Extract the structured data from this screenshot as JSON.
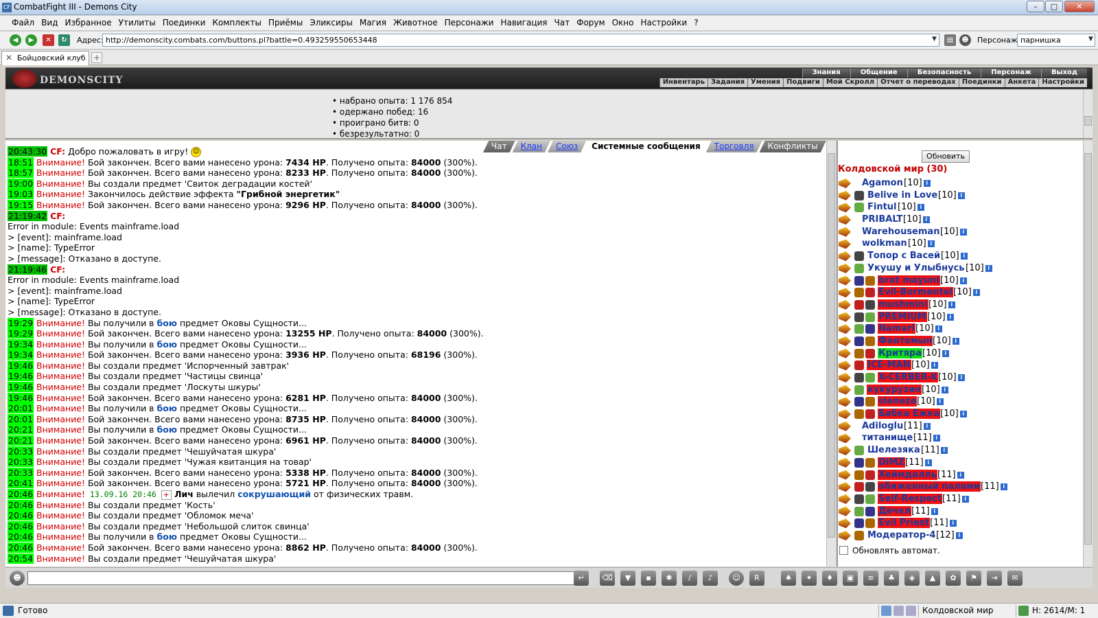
{
  "window": {
    "title": "CombatFight III - Demons City",
    "icon": "CF"
  },
  "menu": [
    "Файл",
    "Вид",
    "Избранное",
    "Утилиты",
    "Поединки",
    "Комплекты",
    "Приёмы",
    "Эликсиры",
    "Магия",
    "Животное",
    "Персонажи",
    "Навигация",
    "Чат",
    "Форум",
    "Окно",
    "Настройки",
    "?"
  ],
  "address": {
    "label": "Адрес:",
    "url": "http://demonscity.combats.com/buttons.pl?battle=0.493259550653448"
  },
  "persona": {
    "label": "Персонаж:",
    "value": "парнишка"
  },
  "tab": {
    "label": "Бойцовский клуб"
  },
  "game": {
    "logo": "DEMONSCITY",
    "nav_top": [
      "Знания",
      "Общение",
      "Безопасность",
      "Персонаж",
      "Выход"
    ],
    "nav_bottom": [
      "Инвентарь",
      "Задания",
      "Умения",
      "Подвиги",
      "Мой Скролл",
      "Отчет о переводах",
      "Поединки",
      "Анкета",
      "Настройки"
    ]
  },
  "stats": [
    "набрано опыта: 1 176 854",
    "одержано побед: 16",
    "проиграно битв: 0",
    "безрезультатно: 0"
  ],
  "chat_tabs": [
    {
      "label": "Чат",
      "style": "plain"
    },
    {
      "label": "Клан",
      "style": "link"
    },
    {
      "label": "Союз",
      "style": "link"
    },
    {
      "label": "Системные сообщения",
      "style": "active"
    },
    {
      "label": "Торговля",
      "style": "link"
    },
    {
      "label": "Конфликты",
      "style": "plain"
    }
  ],
  "chat_lines": [
    {
      "t": "20:43:30",
      "parts": [
        {
          "c": "cf",
          "v": "CF:"
        },
        {
          "v": " Добро пожаловать в игру! "
        }
      ],
      "smiley": true
    },
    {
      "t": "18:51",
      "parts": [
        {
          "c": "warn",
          "v": "Внимание!"
        },
        {
          "v": " Бой закончен. Всего вами нанесено урона: "
        },
        {
          "c": "b",
          "v": "7434 HP"
        },
        {
          "v": ". Получено опыта: "
        },
        {
          "c": "b",
          "v": "84000"
        },
        {
          "v": " (300%)."
        }
      ]
    },
    {
      "t": "18:57",
      "parts": [
        {
          "c": "warn",
          "v": "Внимание!"
        },
        {
          "v": " Бой закончен. Всего вами нанесено урона: "
        },
        {
          "c": "b",
          "v": "8233 HP"
        },
        {
          "v": ". Получено опыта: "
        },
        {
          "c": "b",
          "v": "84000"
        },
        {
          "v": " (300%)."
        }
      ]
    },
    {
      "t": "19:00",
      "parts": [
        {
          "c": "warn",
          "v": "Внимание!"
        },
        {
          "v": " Вы создали предмет 'Свиток деградации костей'"
        }
      ]
    },
    {
      "t": "19:03",
      "parts": [
        {
          "c": "warn",
          "v": "Внимание!"
        },
        {
          "v": " Закончилось действие эффекта "
        },
        {
          "c": "b",
          "v": "\"Грибной энергетик\""
        }
      ]
    },
    {
      "t": "19:15",
      "parts": [
        {
          "c": "warn",
          "v": "Внимание!"
        },
        {
          "v": " Бой закончен. Всего вами нанесено урона: "
        },
        {
          "c": "b",
          "v": "9296 HP"
        },
        {
          "v": ". Получено опыта: "
        },
        {
          "c": "b",
          "v": "84000"
        },
        {
          "v": " (300%)."
        }
      ]
    },
    {
      "t": "21:19:42",
      "parts": [
        {
          "c": "cf",
          "v": "CF:"
        }
      ]
    },
    {
      "parts": [
        {
          "v": "Error in module: Events mainframe.load"
        }
      ]
    },
    {
      "parts": [
        {
          "v": "> [event]: mainframe.load"
        }
      ]
    },
    {
      "parts": [
        {
          "v": "> [name]: TypeError"
        }
      ]
    },
    {
      "parts": [
        {
          "v": "> [message]: Отказано в доступе."
        }
      ]
    },
    {
      "t": "21:19:46",
      "parts": [
        {
          "c": "cf",
          "v": "CF:"
        }
      ]
    },
    {
      "parts": [
        {
          "v": "Error in module: Events mainframe.load"
        }
      ]
    },
    {
      "parts": [
        {
          "v": "> [event]: mainframe.load"
        }
      ]
    },
    {
      "parts": [
        {
          "v": "> [name]: TypeError"
        }
      ]
    },
    {
      "parts": [
        {
          "v": "> [message]: Отказано в доступе."
        }
      ]
    },
    {
      "t": "19:29",
      "parts": [
        {
          "c": "warn",
          "v": "Внимание!"
        },
        {
          "v": " Вы получили в "
        },
        {
          "c": "blue",
          "v": "бою"
        },
        {
          "v": " предмет Оковы Сущности..."
        }
      ]
    },
    {
      "t": "19:29",
      "parts": [
        {
          "c": "warn",
          "v": "Внимание!"
        },
        {
          "v": " Бой закончен. Всего вами нанесено урона: "
        },
        {
          "c": "b",
          "v": "13255 HP"
        },
        {
          "v": ". Получено опыта: "
        },
        {
          "c": "b",
          "v": "84000"
        },
        {
          "v": " (300%)."
        }
      ]
    },
    {
      "t": "19:34",
      "parts": [
        {
          "c": "warn",
          "v": "Внимание!"
        },
        {
          "v": " Вы получили в "
        },
        {
          "c": "blue",
          "v": "бою"
        },
        {
          "v": " предмет Оковы Сущности..."
        }
      ]
    },
    {
      "t": "19:34",
      "parts": [
        {
          "c": "warn",
          "v": "Внимание!"
        },
        {
          "v": " Бой закончен. Всего вами нанесено урона: "
        },
        {
          "c": "b",
          "v": "3936 HP"
        },
        {
          "v": ". Получено опыта: "
        },
        {
          "c": "b",
          "v": "68196"
        },
        {
          "v": " (300%)."
        }
      ]
    },
    {
      "t": "19:46",
      "parts": [
        {
          "c": "warn",
          "v": "Внимание!"
        },
        {
          "v": " Вы создали предмет 'Испорченный завтрак'"
        }
      ]
    },
    {
      "t": "19:46",
      "parts": [
        {
          "c": "warn",
          "v": "Внимание!"
        },
        {
          "v": " Вы создали предмет 'Частицы свинца'"
        }
      ]
    },
    {
      "t": "19:46",
      "parts": [
        {
          "c": "warn",
          "v": "Внимание!"
        },
        {
          "v": " Вы создали предмет 'Лоскуты шкуры'"
        }
      ]
    },
    {
      "t": "19:46",
      "parts": [
        {
          "c": "warn",
          "v": "Внимание!"
        },
        {
          "v": " Бой закончен. Всего вами нанесено урона: "
        },
        {
          "c": "b",
          "v": "6281 HP"
        },
        {
          "v": ". Получено опыта: "
        },
        {
          "c": "b",
          "v": "84000"
        },
        {
          "v": " (300%)."
        }
      ]
    },
    {
      "t": "20:01",
      "parts": [
        {
          "c": "warn",
          "v": "Внимание!"
        },
        {
          "v": " Вы получили в "
        },
        {
          "c": "blue",
          "v": "бою"
        },
        {
          "v": " предмет Оковы Сущности..."
        }
      ]
    },
    {
      "t": "20:01",
      "parts": [
        {
          "c": "warn",
          "v": "Внимание!"
        },
        {
          "v": " Бой закончен. Всего вами нанесено урона: "
        },
        {
          "c": "b",
          "v": "8735 HP"
        },
        {
          "v": ". Получено опыта: "
        },
        {
          "c": "b",
          "v": "84000"
        },
        {
          "v": " (300%)."
        }
      ]
    },
    {
      "t": "20:21",
      "parts": [
        {
          "c": "warn",
          "v": "Внимание!"
        },
        {
          "v": " Вы получили в "
        },
        {
          "c": "blue",
          "v": "бою"
        },
        {
          "v": " предмет Оковы Сущности..."
        }
      ]
    },
    {
      "t": "20:21",
      "parts": [
        {
          "c": "warn",
          "v": "Внимание!"
        },
        {
          "v": " Бой закончен. Всего вами нанесено урона: "
        },
        {
          "c": "b",
          "v": "6961 HP"
        },
        {
          "v": ". Получено опыта: "
        },
        {
          "c": "b",
          "v": "84000"
        },
        {
          "v": " (300%)."
        }
      ]
    },
    {
      "t": "20:33",
      "parts": [
        {
          "c": "warn",
          "v": "Внимание!"
        },
        {
          "v": " Вы создали предмет 'Чешуйчатая шкура'"
        }
      ]
    },
    {
      "t": "20:33",
      "parts": [
        {
          "c": "warn",
          "v": "Внимание!"
        },
        {
          "v": " Вы создали предмет 'Чужая квитанция на товар'"
        }
      ]
    },
    {
      "t": "20:33",
      "parts": [
        {
          "c": "warn",
          "v": "Внимание!"
        },
        {
          "v": " Бой закончен. Всего вами нанесено урона: "
        },
        {
          "c": "b",
          "v": "5338 HP"
        },
        {
          "v": ". Получено опыта: "
        },
        {
          "c": "b",
          "v": "84000"
        },
        {
          "v": " (300%)."
        }
      ]
    },
    {
      "t": "20:41",
      "parts": [
        {
          "c": "warn",
          "v": "Внимание!"
        },
        {
          "v": " Бой закончен. Всего вами нанесено урона: "
        },
        {
          "c": "b",
          "v": "5721 HP"
        },
        {
          "v": ". Получено опыта: "
        },
        {
          "c": "b",
          "v": "84000"
        },
        {
          "v": " (300%)."
        }
      ]
    },
    {
      "t": "20:46",
      "parts": [
        {
          "c": "warn",
          "v": "Внимание!"
        },
        {
          "c": "green",
          "v": " 13.09.16 20:46 "
        },
        {
          "c": "icon",
          "v": "+"
        },
        {
          "c": "b",
          "v": " Лич"
        },
        {
          "v": " вылечил "
        },
        {
          "c": "blue",
          "v": "сокрушающий"
        },
        {
          "v": " от физических травм."
        }
      ]
    },
    {
      "t": "20:46",
      "parts": [
        {
          "c": "warn",
          "v": "Внимание!"
        },
        {
          "v": " Вы создали предмет 'Кость'"
        }
      ]
    },
    {
      "t": "20:46",
      "parts": [
        {
          "c": "warn",
          "v": "Внимание!"
        },
        {
          "v": " Вы создали предмет 'Обломок меча'"
        }
      ]
    },
    {
      "t": "20:46",
      "parts": [
        {
          "c": "warn",
          "v": "Внимание!"
        },
        {
          "v": " Вы создали предмет 'Небольшой слиток свинца'"
        }
      ]
    },
    {
      "t": "20:46",
      "parts": [
        {
          "c": "warn",
          "v": "Внимание!"
        },
        {
          "v": " Вы получили в "
        },
        {
          "c": "blue",
          "v": "бою"
        },
        {
          "v": " предмет Оковы Сущности..."
        }
      ]
    },
    {
      "t": "20:46",
      "parts": [
        {
          "c": "warn",
          "v": "Внимание!"
        },
        {
          "v": " Бой закончен. Всего вами нанесено урона: "
        },
        {
          "c": "b",
          "v": "8862 HP"
        },
        {
          "v": ". Получено опыта: "
        },
        {
          "c": "b",
          "v": "84000"
        },
        {
          "v": " (300%)."
        }
      ]
    },
    {
      "t": "20:54",
      "parts": [
        {
          "c": "warn",
          "v": "Внимание!"
        },
        {
          "v": " Вы создали предмет 'Чешуйчатая шкура'"
        }
      ]
    }
  ],
  "right": {
    "refresh_label": "Обновить",
    "room_title": "Колдовской мир (30)",
    "auto_refresh_label": "Обновлять автомат.",
    "users": [
      {
        "name": "Agamon",
        "lvl": "[10]",
        "hl": "",
        "badges": 0
      },
      {
        "name": "Belive in Love",
        "lvl": "[10]",
        "hl": "",
        "badges": 1
      },
      {
        "name": "Fintul",
        "lvl": "[10]",
        "hl": "",
        "badges": 1
      },
      {
        "name": "PRIBALT",
        "lvl": "[10]",
        "hl": "",
        "badges": 0
      },
      {
        "name": "Warehouseman",
        "lvl": "[10]",
        "hl": "",
        "badges": 0
      },
      {
        "name": "wolkman",
        "lvl": "[10]",
        "hl": "",
        "badges": 0
      },
      {
        "name": "Топор с Васей",
        "lvl": "[10]",
        "hl": "",
        "badges": 1
      },
      {
        "name": "Укушу и Улыбнусь",
        "lvl": "[10]",
        "hl": "",
        "badges": 1
      },
      {
        "name": "brat mayuni",
        "lvl": "[10]",
        "hl": "red",
        "badges": 2
      },
      {
        "name": "Evil-Bormental",
        "lvl": "[10]",
        "hl": "red",
        "badges": 2
      },
      {
        "name": "mushmini",
        "lvl": "[10]",
        "hl": "red",
        "badges": 2
      },
      {
        "name": "PREMIUM",
        "lvl": "[10]",
        "hl": "red",
        "badges": 2
      },
      {
        "name": "Namari",
        "lvl": "[10]",
        "hl": "red",
        "badges": 2
      },
      {
        "name": "Фантомын",
        "lvl": "[10]",
        "hl": "red",
        "badges": 2
      },
      {
        "name": "Критяра",
        "lvl": "[10]",
        "hl": "green",
        "badges": 2
      },
      {
        "name": "ICE-MAN",
        "lvl": "[10]",
        "hl": "red",
        "badges": 1
      },
      {
        "name": "X-CERBER-X",
        "lvl": "[10]",
        "hl": "red",
        "badges": 2
      },
      {
        "name": "кукурузин",
        "lvl": "[10]",
        "hl": "red",
        "badges": 1
      },
      {
        "name": "sleneze",
        "lvl": "[10]",
        "hl": "red",
        "badges": 2
      },
      {
        "name": "Бабка Ежка",
        "lvl": "[10]",
        "hl": "red",
        "badges": 2
      },
      {
        "name": "Adiloglu",
        "lvl": "[11]",
        "hl": "",
        "badges": 0
      },
      {
        "name": "титанище",
        "lvl": "[11]",
        "hl": "",
        "badges": 0
      },
      {
        "name": "Шелезяка",
        "lvl": "[11]",
        "hl": "",
        "badges": 1
      },
      {
        "name": "DIMZ",
        "lvl": "[11]",
        "hl": "red",
        "badges": 2
      },
      {
        "name": "Хеймдалль",
        "lvl": "[11]",
        "hl": "red",
        "badges": 2
      },
      {
        "name": "обиженный палами",
        "lvl": "[11]",
        "hl": "red",
        "badges": 2
      },
      {
        "name": "Self-Respect",
        "lvl": "[11]",
        "hl": "red",
        "badges": 2
      },
      {
        "name": "Двчел",
        "lvl": "[11]",
        "hl": "red",
        "badges": 2
      },
      {
        "name": "Evil Priest",
        "lvl": "[11]",
        "hl": "red",
        "badges": 2
      },
      {
        "name": "Модератор-4",
        "lvl": "[12]",
        "hl": "",
        "badges": 1
      }
    ]
  },
  "status": {
    "text": "Готово",
    "room": "Колдовской мир",
    "hp": "H: 2614/M: 1"
  }
}
